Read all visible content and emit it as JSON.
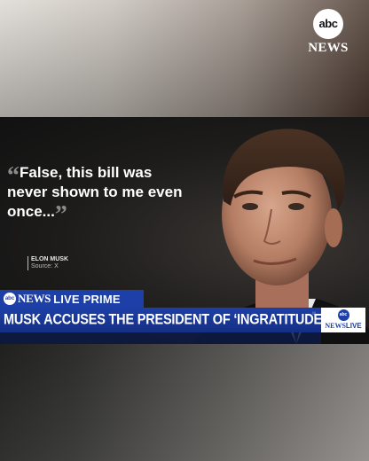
{
  "top_logo": {
    "abc": "abc",
    "news": "NEWS"
  },
  "quote": {
    "open_mark": "“",
    "text": "False, this bill was never shown to me even once...",
    "close_mark": "”"
  },
  "attribution": {
    "name": "ELON MUSK",
    "source": "Source: X"
  },
  "show_bar": {
    "abc": "abc",
    "news": "NEWS",
    "live": "LIVE PRIME"
  },
  "headline": "MUSK ACCUSES THE PRESIDENT OF ‘INGRATITUDE’",
  "live_logo": {
    "abc": "abc",
    "news": "NEWS",
    "live": "LIVE"
  },
  "colors": {
    "brand_blue": "#1c3fa8",
    "headline_bar": "#152f84",
    "text_white": "#ffffff"
  },
  "icons": [
    "abc-news-logo",
    "abc-news-live-logo",
    "portrait-image"
  ]
}
